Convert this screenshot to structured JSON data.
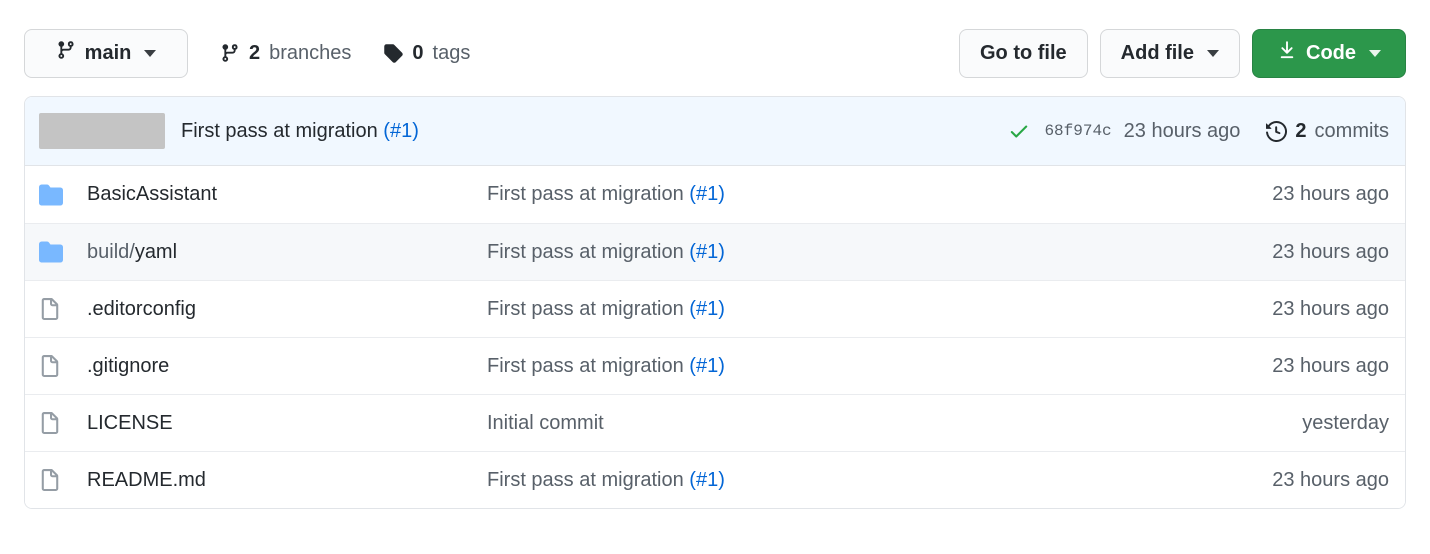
{
  "toolbar": {
    "branch_button": {
      "label": "main",
      "icon": "git-branch-icon"
    },
    "branches": {
      "count": "2",
      "label": "branches",
      "icon": "git-branch-icon"
    },
    "tags": {
      "count": "0",
      "label": "tags",
      "icon": "tag-icon"
    },
    "go_to_file": "Go to file",
    "add_file": "Add file",
    "code": "Code"
  },
  "latest_commit": {
    "author_redacted": true,
    "message": "First pass at migration",
    "issue_ref": "(#1)",
    "status_icon": "check-icon",
    "sha": "68f974c",
    "age": "23 hours ago",
    "commits_count": "2",
    "commits_label": "commits",
    "history_icon": "history-icon"
  },
  "files": [
    {
      "name": "BasicAssistant",
      "prefix": "",
      "type": "folder",
      "icon": "folder-icon",
      "message": "First pass at migration",
      "issue_ref": "(#1)",
      "age": "23 hours ago",
      "hover": false
    },
    {
      "name": "yaml",
      "prefix": "build/",
      "type": "folder",
      "icon": "folder-icon",
      "message": "First pass at migration",
      "issue_ref": "(#1)",
      "age": "23 hours ago",
      "hover": true
    },
    {
      "name": ".editorconfig",
      "prefix": "",
      "type": "file",
      "icon": "file-icon",
      "message": "First pass at migration",
      "issue_ref": "(#1)",
      "age": "23 hours ago",
      "hover": false
    },
    {
      "name": ".gitignore",
      "prefix": "",
      "type": "file",
      "icon": "file-icon",
      "message": "First pass at migration",
      "issue_ref": "(#1)",
      "age": "23 hours ago",
      "hover": false
    },
    {
      "name": "LICENSE",
      "prefix": "",
      "type": "file",
      "icon": "file-icon",
      "message": "Initial commit",
      "issue_ref": "",
      "age": "yesterday",
      "hover": false
    },
    {
      "name": "README.md",
      "prefix": "",
      "type": "file",
      "icon": "file-icon",
      "message": "First pass at migration",
      "issue_ref": "(#1)",
      "age": "23 hours ago",
      "hover": false
    }
  ],
  "colors": {
    "code_button_green": "#2c974b",
    "link_blue": "#0366d6",
    "folder_blue": "#79b8ff",
    "commit_bar_blue": "#f1f8ff",
    "success_green": "#28a745",
    "muted_gray": "#586069",
    "row_hover": "#f6f8fa"
  }
}
